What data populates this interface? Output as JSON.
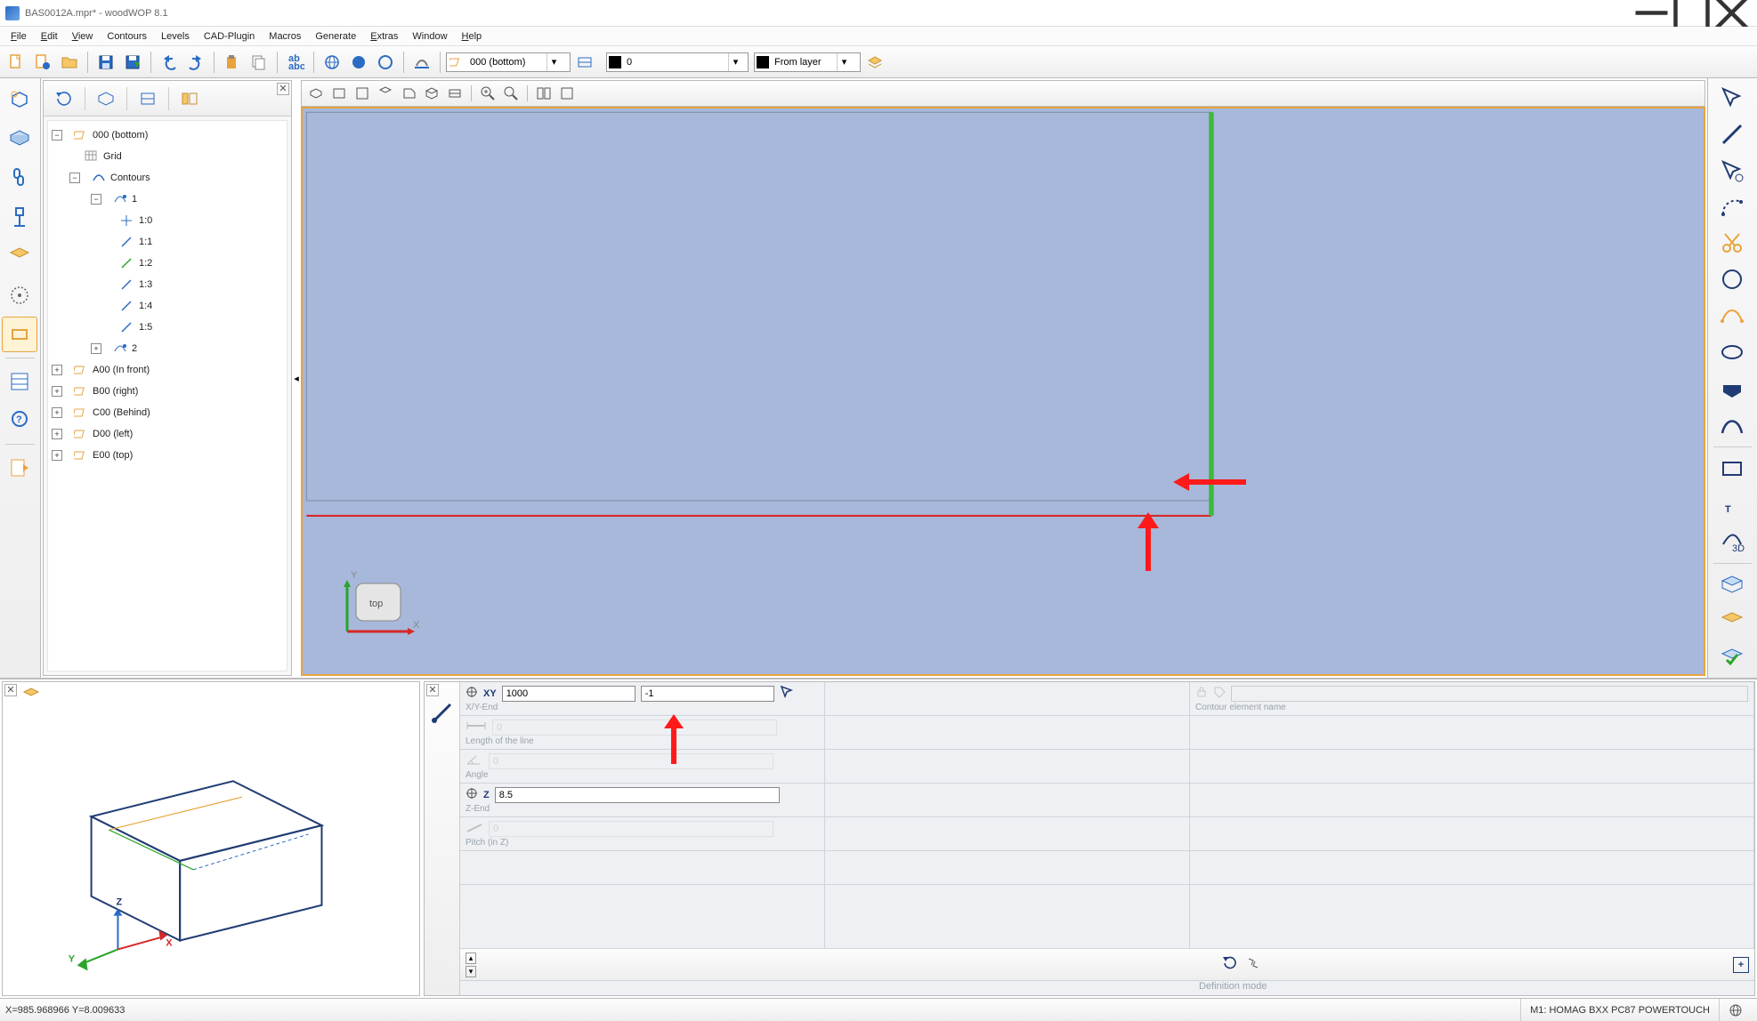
{
  "window": {
    "title": "BAS0012A.mpr* - woodWOP 8.1"
  },
  "menu": {
    "file": "File",
    "edit": "Edit",
    "view": "View",
    "contours": "Contours",
    "levels": "Levels",
    "cadplugin": "CAD-Plugin",
    "macros": "Macros",
    "generate": "Generate",
    "extras": "Extras",
    "window": "Window",
    "help": "Help"
  },
  "toolbar": {
    "level_combo": "000 (bottom)",
    "layer_combo_value": "0",
    "fromlayer_value": "From layer"
  },
  "tree": {
    "root_label": "000 (bottom)",
    "grid_label": "Grid",
    "contours_label": "Contours",
    "c1_label": "1",
    "seg10": "1:0",
    "seg11": "1:1",
    "seg12": "1:2",
    "seg13": "1:3",
    "seg14": "1:4",
    "seg15": "1:5",
    "c2_label": "2",
    "a00": "A00 (In front)",
    "b00": "B00 (right)",
    "c00": "C00 (Behind)",
    "d00": "D00 (left)",
    "e00": "E00 (top)"
  },
  "canvas": {
    "orient_label": "top",
    "y_label": "Y",
    "x_label": "X"
  },
  "props": {
    "xy_label": "XY",
    "xy_x": "1000",
    "xy_y": "-1",
    "xy_caption": "X/Y-End",
    "len_value": "0",
    "len_caption": "Length of the line",
    "angle_value": "0",
    "angle_caption": "Angle",
    "z_label": "Z",
    "z_value": "8.5",
    "z_caption": "Z-End",
    "pitch_value": "0",
    "pitch_caption": "Pitch (in Z)",
    "name_caption": "Contour element name",
    "defmode_caption": "Definition mode"
  },
  "status": {
    "coords": "X=985.968966 Y=8.009633",
    "machine": "M1: HOMAG BXX PC87 POWERTOUCH"
  }
}
